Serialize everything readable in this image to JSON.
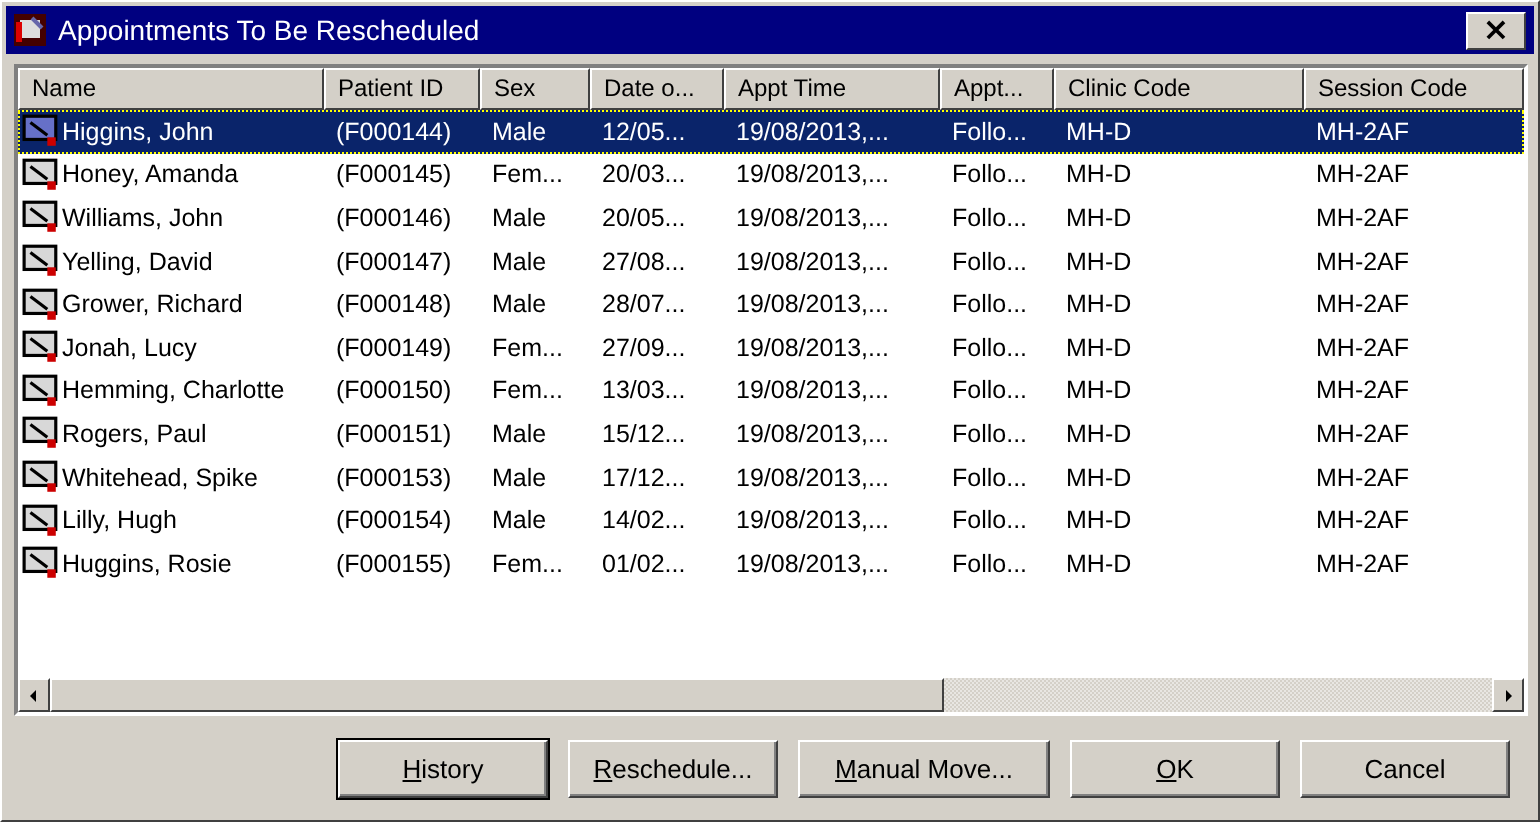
{
  "window": {
    "title": "Appointments To Be Rescheduled",
    "close_label": "×"
  },
  "table": {
    "columns": [
      {
        "label": "Name"
      },
      {
        "label": "Patient ID"
      },
      {
        "label": "Sex"
      },
      {
        "label": "Date o..."
      },
      {
        "label": "Appt Time"
      },
      {
        "label": "Appt..."
      },
      {
        "label": "Clinic Code"
      },
      {
        "label": "Session Code"
      }
    ],
    "rows": [
      {
        "selected": true,
        "cells": [
          "Higgins, John",
          "(F000144)",
          "Male",
          "12/05...",
          "19/08/2013,...",
          "Follo...",
          "MH-D",
          "MH-2AF"
        ]
      },
      {
        "selected": false,
        "cells": [
          "Honey, Amanda",
          "(F000145)",
          "Fem...",
          "20/03...",
          "19/08/2013,...",
          "Follo...",
          "MH-D",
          "MH-2AF"
        ]
      },
      {
        "selected": false,
        "cells": [
          "Williams, John",
          "(F000146)",
          "Male",
          "20/05...",
          "19/08/2013,...",
          "Follo...",
          "MH-D",
          "MH-2AF"
        ]
      },
      {
        "selected": false,
        "cells": [
          "Yelling, David",
          "(F000147)",
          "Male",
          "27/08...",
          "19/08/2013,...",
          "Follo...",
          "MH-D",
          "MH-2AF"
        ]
      },
      {
        "selected": false,
        "cells": [
          "Grower, Richard",
          "(F000148)",
          "Male",
          "28/07...",
          "19/08/2013,...",
          "Follo...",
          "MH-D",
          "MH-2AF"
        ]
      },
      {
        "selected": false,
        "cells": [
          "Jonah, Lucy",
          "(F000149)",
          "Fem...",
          "27/09...",
          "19/08/2013,...",
          "Follo...",
          "MH-D",
          "MH-2AF"
        ]
      },
      {
        "selected": false,
        "cells": [
          "Hemming, Charlotte",
          "(F000150)",
          "Fem...",
          "13/03...",
          "19/08/2013,...",
          "Follo...",
          "MH-D",
          "MH-2AF"
        ]
      },
      {
        "selected": false,
        "cells": [
          "Rogers, Paul",
          "(F000151)",
          "Male",
          "15/12...",
          "19/08/2013,...",
          "Follo...",
          "MH-D",
          "MH-2AF"
        ]
      },
      {
        "selected": false,
        "cells": [
          "Whitehead, Spike",
          "(F000153)",
          "Male",
          "17/12...",
          "19/08/2013,...",
          "Follo...",
          "MH-D",
          "MH-2AF"
        ]
      },
      {
        "selected": false,
        "cells": [
          "Lilly, Hugh",
          "(F000154)",
          "Male",
          "14/02...",
          "19/08/2013,...",
          "Follo...",
          "MH-D",
          "MH-2AF"
        ]
      },
      {
        "selected": false,
        "cells": [
          "Huggins, Rosie",
          "(F000155)",
          "Fem...",
          "01/02...",
          "19/08/2013,...",
          "Follo...",
          "MH-D",
          "MH-2AF"
        ]
      }
    ]
  },
  "buttons": [
    {
      "key": "H",
      "after": "istory",
      "default": true
    },
    {
      "key": "R",
      "after": "eschedule...",
      "default": false
    },
    {
      "key": "M",
      "after": "anual Move...",
      "default": false
    },
    {
      "key": "O",
      "after": "K",
      "default": false
    },
    {
      "after": "Cancel",
      "default": false
    }
  ]
}
